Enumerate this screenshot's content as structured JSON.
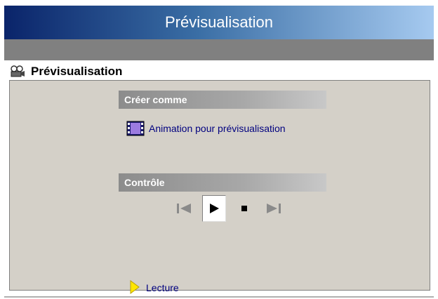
{
  "window": {
    "title": "Prévisualisation"
  },
  "panel": {
    "title": "Prévisualisation",
    "icon": "projector-icon"
  },
  "sections": {
    "create_as": {
      "label": "Créer comme",
      "option_label": "Animation pour prévisualisation",
      "option_icon": "film-icon"
    },
    "control": {
      "label": "Contrôle",
      "buttons": [
        "skip-to-start",
        "play",
        "stop",
        "skip-to-end"
      ]
    }
  },
  "action": {
    "label": "Lecture",
    "icon": "yellow-arrow-icon"
  },
  "colors": {
    "title_gradient_start": "#0a246a",
    "title_gradient_end": "#a6caf0",
    "panel_bg": "#d4d0c8",
    "link_text": "#00007f",
    "section_bar": "#a8a8a8",
    "arrow": "#ffe600"
  }
}
